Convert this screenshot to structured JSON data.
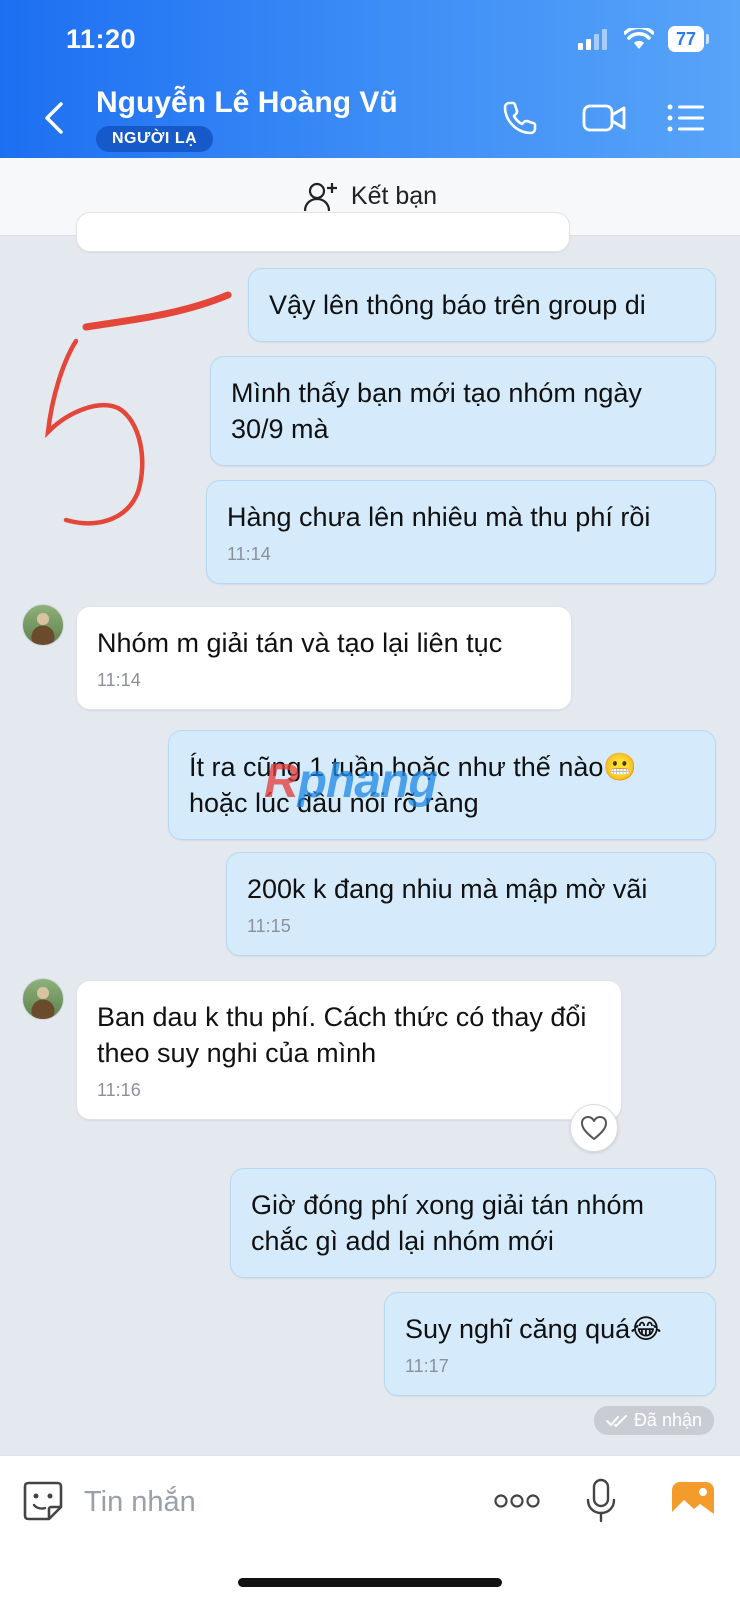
{
  "status_bar": {
    "time": "11:20",
    "battery": "77"
  },
  "header": {
    "contact_name": "Nguyễn Lê Hoàng Vũ",
    "badge": "NGƯỜI LẠ"
  },
  "add_friend": {
    "label": "Kết bạn"
  },
  "messages": [
    {
      "side": "out",
      "text": "Vậy lên thông báo trên group di",
      "time": ""
    },
    {
      "side": "out",
      "text": "Mình thấy bạn mới tạo nhóm ngày 30/9 mà",
      "time": ""
    },
    {
      "side": "out",
      "text": "Hàng chưa lên nhiêu mà thu phí rồi",
      "time": "11:14"
    },
    {
      "side": "in",
      "text": "Nhóm m giải tán và tạo lại liên tục",
      "time": "11:14"
    },
    {
      "side": "out",
      "text": "Ít ra cũng 1 tuần hoặc như thế nào😬 hoặc lúc đầu nói rõ ràng",
      "time": ""
    },
    {
      "side": "out",
      "text": "200k k đang nhiu mà mập mờ vãi",
      "time": "11:15"
    },
    {
      "side": "in",
      "text": "Ban dau k thu phí. Cách thức có thay đổi theo suy nghi của mình",
      "time": "11:16"
    },
    {
      "side": "out",
      "text": "Giờ đóng phí xong giải tán nhóm chắc gì add lại nhóm mới",
      "time": ""
    },
    {
      "side": "out",
      "text": "Suy nghĩ căng quá😂",
      "time": "11:17"
    }
  ],
  "seen_status": "Đã nhận",
  "watermark": {
    "part1": "R",
    "part2": "phang"
  },
  "input": {
    "placeholder": "Tin nhắn"
  },
  "colors": {
    "header_start": "#1d6ff2",
    "header_end": "#58a4f9",
    "out_bubble": "#d5ebfc",
    "in_bubble": "#ffffff",
    "annotation": "#e4463a"
  }
}
